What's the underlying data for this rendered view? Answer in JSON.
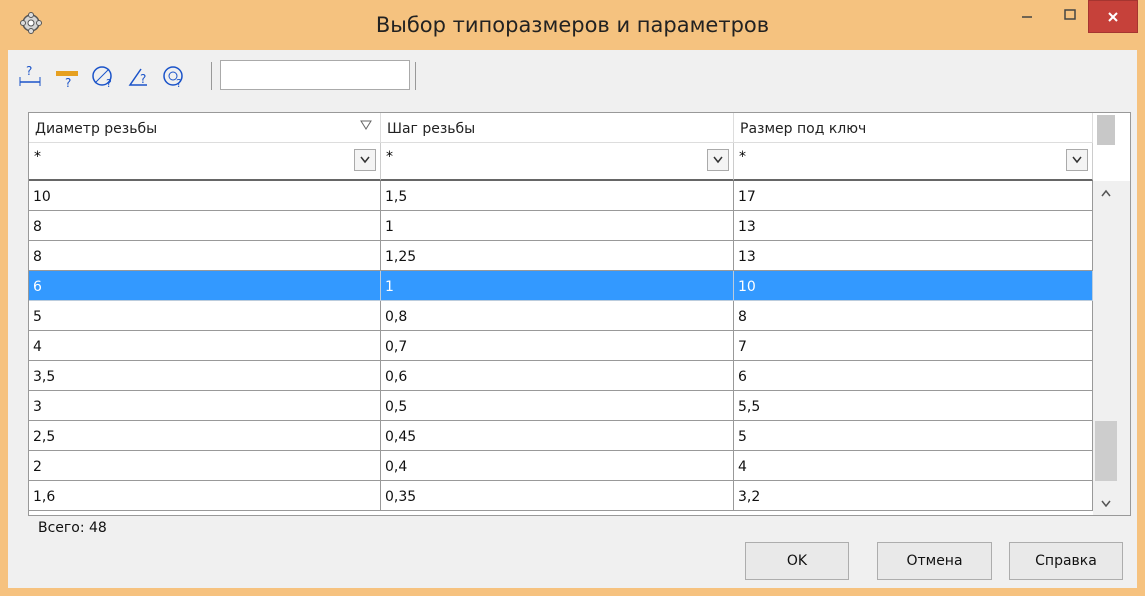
{
  "window": {
    "title": "Выбор типоразмеров и параметров"
  },
  "toolbar": {
    "search_value": ""
  },
  "grid": {
    "columns": [
      "Диаметр резьбы",
      "Шаг резьбы",
      "Размер под ключ"
    ],
    "filters": [
      "*",
      "*",
      "*"
    ],
    "rows": [
      [
        "10",
        "1,5",
        "17"
      ],
      [
        "8",
        "1",
        "13"
      ],
      [
        "8",
        "1,25",
        "13"
      ],
      [
        "6",
        "1",
        "10"
      ],
      [
        "5",
        "0,8",
        "8"
      ],
      [
        "4",
        "0,7",
        "7"
      ],
      [
        "3,5",
        "0,6",
        "6"
      ],
      [
        "3",
        "0,5",
        "5,5"
      ],
      [
        "2,5",
        "0,45",
        "5"
      ],
      [
        "2",
        "0,4",
        "4"
      ],
      [
        "1,6",
        "0,35",
        "3,2"
      ]
    ],
    "selected_row": 3
  },
  "footer": {
    "total": "Всего: 48"
  },
  "buttons": {
    "ok": "OK",
    "cancel": "Отмена",
    "help": "Справка"
  },
  "colors": {
    "accent": "#3399ff",
    "titlebar": "#f5c27f",
    "close": "#c6413a"
  }
}
